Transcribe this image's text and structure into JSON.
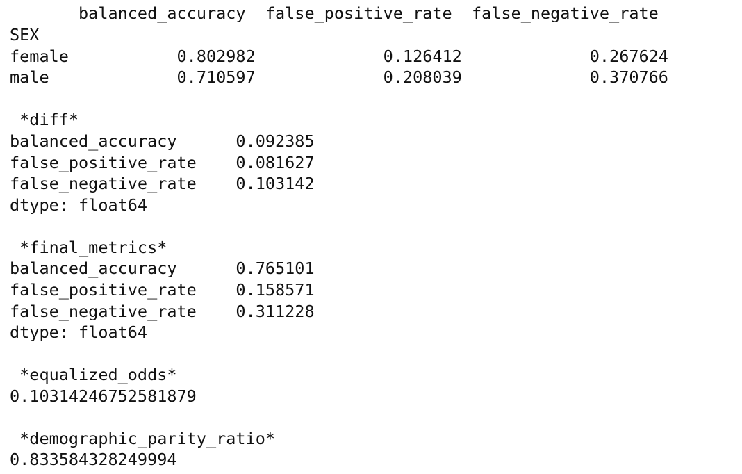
{
  "output": {
    "groupby_table": {
      "header": "       balanced_accuracy  false_positive_rate  false_negative_rate",
      "index_name": "SEX",
      "rows": [
        "female           0.802982             0.126412             0.267624",
        "male             0.710597             0.208039             0.370766"
      ]
    },
    "diff": {
      "title": " *diff*",
      "rows": [
        "balanced_accuracy      0.092385",
        "false_positive_rate    0.081627",
        "false_negative_rate    0.103142"
      ],
      "dtype": "dtype: float64"
    },
    "final_metrics": {
      "title": " *final_metrics*",
      "rows": [
        "balanced_accuracy      0.765101",
        "false_positive_rate    0.158571",
        "false_negative_rate    0.311228"
      ],
      "dtype": "dtype: float64"
    },
    "equalized_odds": {
      "title": " *equalized_odds*",
      "value": "0.10314246752581879"
    },
    "demographic_parity_ratio": {
      "title": " *demographic_parity_ratio*",
      "value": "0.833584328249994"
    }
  }
}
